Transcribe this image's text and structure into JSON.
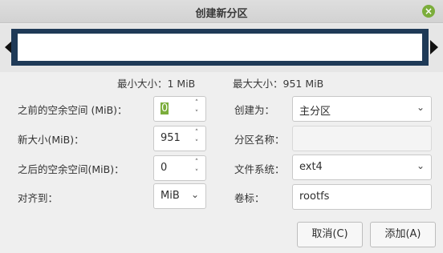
{
  "window": {
    "title": "创建新分区"
  },
  "sizes": {
    "min": "最小大小：1 MiB",
    "max": "最大大小：951 MiB"
  },
  "left": {
    "free_before": {
      "label": "之前的空余空间 (MiB)：",
      "value": "0"
    },
    "new_size": {
      "label": "新大小(MiB)：",
      "value": "951"
    },
    "free_after": {
      "label": "之后的空余空间(MiB)：",
      "value": "0"
    },
    "align": {
      "label": "对齐到：",
      "value": "MiB"
    }
  },
  "right": {
    "create_as": {
      "label": "创建为：",
      "value": "主分区"
    },
    "partition_name": {
      "label": "分区名称：",
      "value": ""
    },
    "filesystem": {
      "label": "文件系统：",
      "value": "ext4"
    },
    "label": {
      "label": "卷标：",
      "value": "rootfs"
    }
  },
  "buttons": {
    "cancel": "取消(C)",
    "add": "添加(A)"
  },
  "colors": {
    "accent": "#7bad3b",
    "map_border": "#1f3a57"
  }
}
